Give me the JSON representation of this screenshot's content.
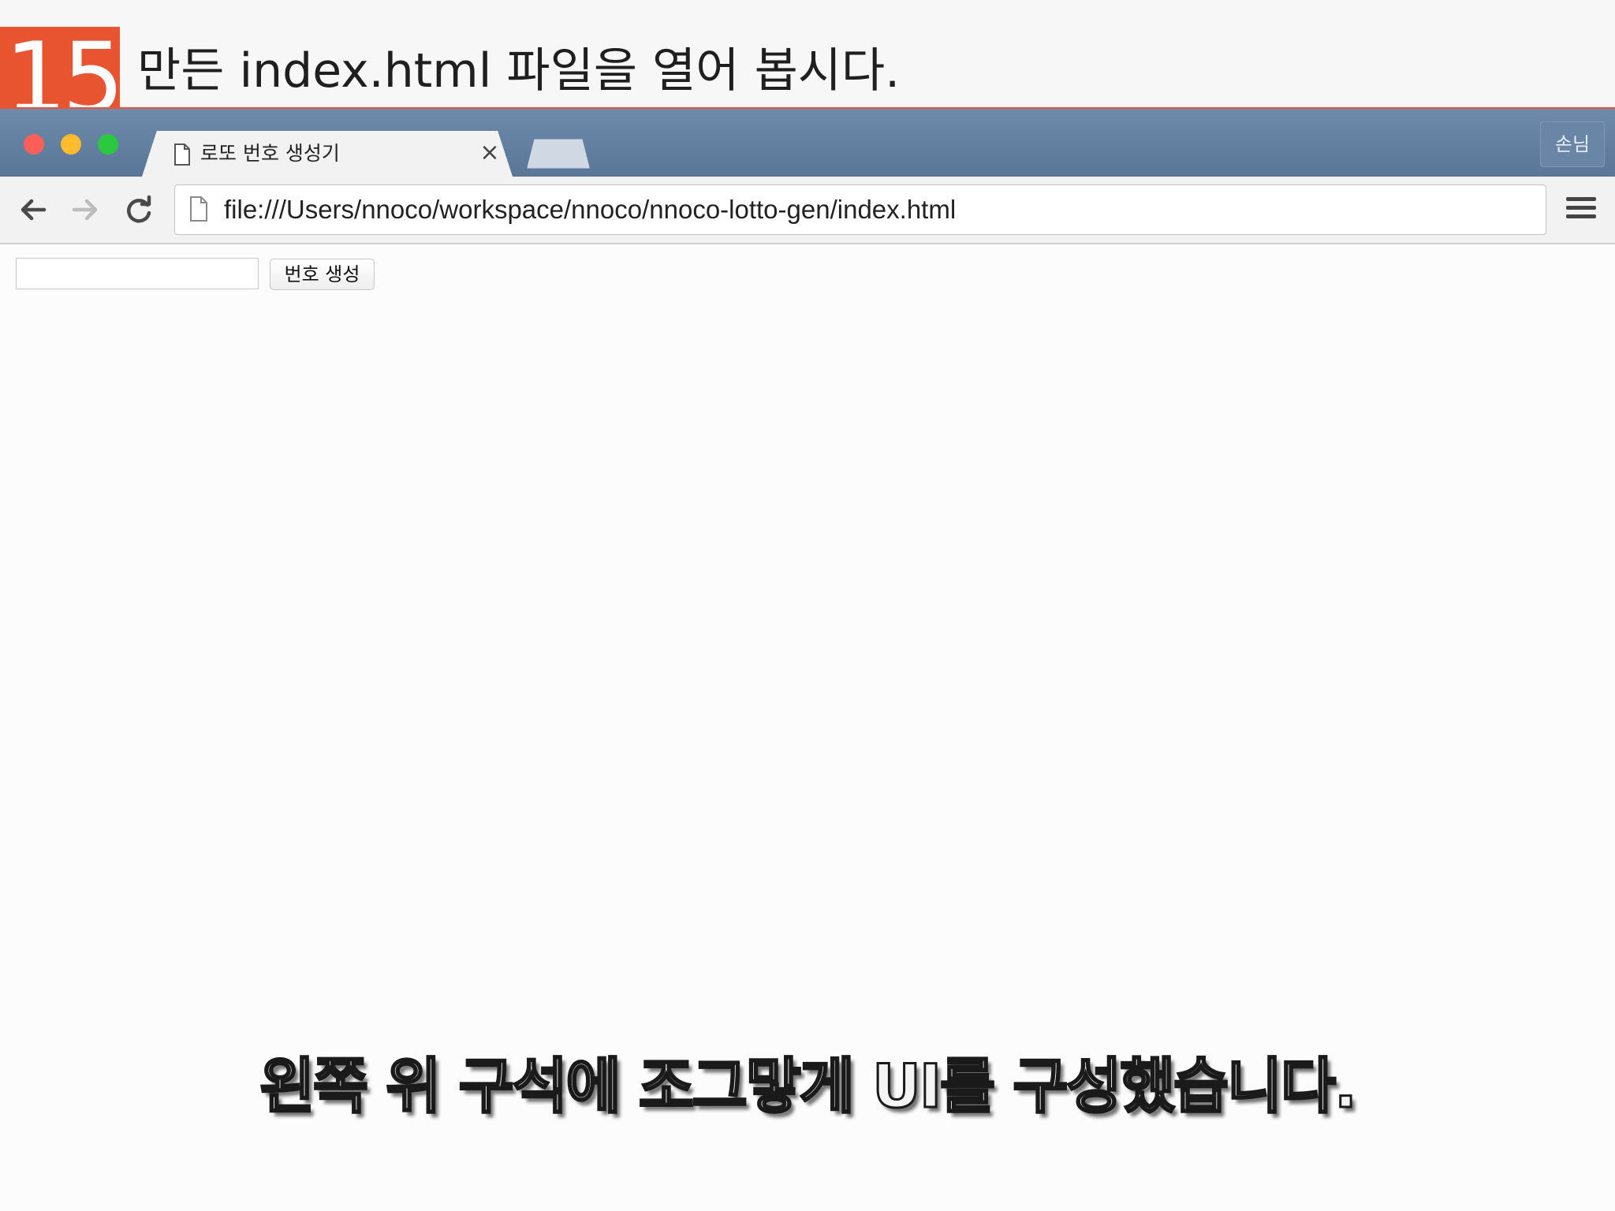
{
  "slide": {
    "step_number": "15",
    "title": "만든 index.html 파일을 열어 봅시다."
  },
  "browser": {
    "tab_title": "로또 번호 생성기",
    "tab_close": "×",
    "guest_label": "손님",
    "url": "file:///Users/nnoco/workspace/nnoco/nnoco-lotto-gen/index.html"
  },
  "page": {
    "input_value": "",
    "button_label": "번호 생성"
  },
  "caption": "왼쪽 위 구석에 조그맣게 UI를 구성했습니다.",
  "colors": {
    "accent": "#e8542f",
    "titlebar": "#5f7c9d",
    "tab": "#f2f2f2"
  }
}
